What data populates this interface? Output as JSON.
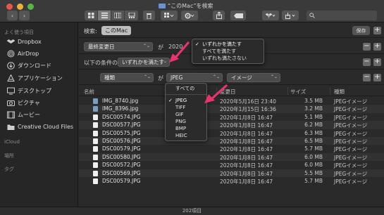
{
  "window": {
    "title": "“このMac”を検索"
  },
  "toolbar": {
    "back_label": "‹",
    "forward_label": "›",
    "view_modes": [
      "icon-view",
      "list-view",
      "column-view",
      "gallery-view"
    ]
  },
  "sidebar": {
    "favorites_header": "よく使う項目",
    "items": [
      {
        "label": "Dropbox",
        "icon": "dropbox-icon"
      },
      {
        "label": "AirDrop",
        "icon": "airdrop-icon"
      },
      {
        "label": "ダウンロード",
        "icon": "download-icon"
      },
      {
        "label": "アプリケーション",
        "icon": "applications-icon"
      },
      {
        "label": "デスクトップ",
        "icon": "desktop-icon"
      },
      {
        "label": "ピクチャ",
        "icon": "pictures-icon"
      },
      {
        "label": "ムービー",
        "icon": "movies-icon"
      },
      {
        "label": "Creative Cloud Files",
        "icon": "folder-icon"
      }
    ],
    "icloud_header": "iCloud",
    "locations_header": "場所",
    "tags_header": "タグ"
  },
  "search": {
    "scope_label": "検索:",
    "scope_value": "このMac",
    "save_label": "保存"
  },
  "criteria": {
    "row1_attribute": "最終変更日",
    "row1_connector": "が",
    "row1_value": "2020",
    "row2_prefix": "以下の条件の",
    "row2_value": "いずれかを満たす",
    "row3_attribute": "種類",
    "row3_connector": "が",
    "row3_kind": "JPEG",
    "row3_detail": "イメージ"
  },
  "table": {
    "headers": {
      "name": "名前",
      "date": "変更日",
      "size": "サイズ",
      "kind": "種類"
    },
    "rows": [
      {
        "name": "IMG_8740.jpg",
        "date": "2020年5月16日 23:40",
        "size": "3.5 MB",
        "kind": "JPEGイメージ",
        "icon": "photo"
      },
      {
        "name": "IMG_8396.jpg",
        "date": "2020年1月15日 16:36",
        "size": "3.2 MB",
        "kind": "JPEGイメージ",
        "icon": "photo"
      },
      {
        "name": "DSC00574.JPG",
        "date": "2020年1月8日 16:47",
        "size": "5.1 MB",
        "kind": "JPEGイメージ",
        "icon": "doc"
      },
      {
        "name": "DSC00577.JPG",
        "date": "2020年1月8日 16:47",
        "size": "6.2 MB",
        "kind": "JPEGイメージ",
        "icon": "doc"
      },
      {
        "name": "DSC00575.JPG",
        "date": "2020年1月8日 16:47",
        "size": "6.3 MB",
        "kind": "JPEGイメージ",
        "icon": "doc"
      },
      {
        "name": "DSC00576.JPG",
        "date": "2020年1月8日 16:47",
        "size": "6.5 MB",
        "kind": "JPEGイメージ",
        "icon": "doc"
      },
      {
        "name": "DSC00579.JPG",
        "date": "2020年1月8日 16:47",
        "size": "5.7 MB",
        "kind": "JPEGイメージ",
        "icon": "doc"
      },
      {
        "name": "DSC00580.JPG",
        "date": "2020年1月8日 16:47",
        "size": "6.0 MB",
        "kind": "JPEGイメージ",
        "icon": "doc"
      },
      {
        "name": "DSC00572.JPG",
        "date": "2020年1月8日 16:47",
        "size": "6.0 MB",
        "kind": "JPEGイメージ",
        "icon": "doc"
      },
      {
        "name": "DSC00569.JPG",
        "date": "2020年1月8日 16:47",
        "size": "5.5 MB",
        "kind": "JPEGイメージ",
        "icon": "doc"
      },
      {
        "name": "DSC00579.JPG",
        "date": "2020年1月8日 16:47",
        "size": "5.7 MB",
        "kind": "JPEGイメージ",
        "icon": "doc"
      }
    ]
  },
  "status": {
    "item_count": "202項目"
  },
  "condition_menu": {
    "items": [
      "いずれかを満たす",
      "すべてを満たす",
      "いずれも満たさない"
    ],
    "selected_index": 0
  },
  "kind_menu": {
    "top_item": "すべての",
    "items": [
      "JPEG",
      "TIFF",
      "GIF",
      "PNG",
      "BMP",
      "HEIC"
    ],
    "selected_index": 0
  },
  "colors": {
    "annotation_arrow": "#e8336d",
    "traffic_red": "#e9544b",
    "traffic_yellow": "#e9b23a",
    "traffic_green": "#58b646"
  }
}
